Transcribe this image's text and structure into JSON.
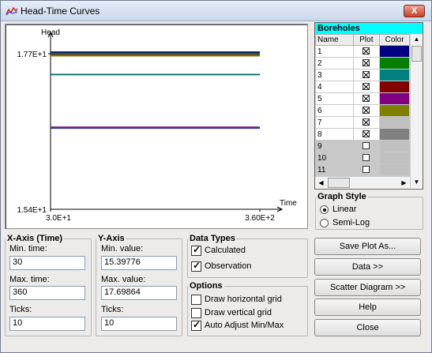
{
  "window": {
    "title": "Head-Time Curves",
    "close_label": "X"
  },
  "chart_data": {
    "type": "line",
    "ylabel": "Head",
    "xlabel": "Time",
    "yticks": [
      "1.77E+1",
      "1.54E+1"
    ],
    "xticks": [
      "3.0E+1",
      "3.60E+2"
    ],
    "ylim": [
      15.39776,
      17.69864
    ],
    "xlim": [
      30,
      360
    ],
    "series": [
      {
        "values": [
          17.72,
          17.72
        ],
        "color": "#0a0a8a"
      },
      {
        "values": [
          17.7,
          17.7
        ],
        "color": "#0a7a0a"
      },
      {
        "values": [
          17.68,
          17.68
        ],
        "color": "#7a0a0a"
      },
      {
        "values": [
          17.67,
          17.67
        ],
        "color": "#808000"
      },
      {
        "values": [
          17.39,
          17.39
        ],
        "color": "#0a7a7a"
      },
      {
        "values": [
          16.61,
          16.61
        ],
        "color": "#7a0a7a"
      },
      {
        "values": [
          16.6,
          16.6
        ],
        "color": "#3a3a8a"
      }
    ]
  },
  "boreholes": {
    "title": "Boreholes",
    "headers": [
      "Name",
      "Plot",
      "Color"
    ],
    "rows": [
      {
        "name": "1",
        "checked": true,
        "color": "#000080",
        "disabled": false
      },
      {
        "name": "2",
        "checked": true,
        "color": "#008000",
        "disabled": false
      },
      {
        "name": "3",
        "checked": true,
        "color": "#008080",
        "disabled": false
      },
      {
        "name": "4",
        "checked": true,
        "color": "#800000",
        "disabled": false
      },
      {
        "name": "5",
        "checked": true,
        "color": "#800080",
        "disabled": false
      },
      {
        "name": "6",
        "checked": true,
        "color": "#808000",
        "disabled": false
      },
      {
        "name": "7",
        "checked": true,
        "color": "#c0c0c0",
        "disabled": false
      },
      {
        "name": "8",
        "checked": true,
        "color": "#808080",
        "disabled": false
      },
      {
        "name": "9",
        "checked": false,
        "color": "#c0c0c0",
        "disabled": true
      },
      {
        "name": "10",
        "checked": false,
        "color": "#c0c0c0",
        "disabled": true
      },
      {
        "name": "11",
        "checked": false,
        "color": "#c0c0c0",
        "disabled": true
      }
    ]
  },
  "graph_style": {
    "title": "Graph Style",
    "linear": "Linear",
    "semilog": "Semi-Log",
    "selected": "linear"
  },
  "x_axis": {
    "title": "X-Axis (Time)",
    "min_label": "Min. time:",
    "min_value": "30",
    "max_label": "Max. time:",
    "max_value": "360",
    "ticks_label": "Ticks:",
    "ticks_value": "10"
  },
  "y_axis": {
    "title": "Y-Axis",
    "min_label": "Min. value:",
    "min_value": "15.39776",
    "max_label": "Max. value:",
    "max_value": "17.69864",
    "ticks_label": "Ticks:",
    "ticks_value": "10"
  },
  "data_types": {
    "title": "Data Types",
    "calculated": "Calculated",
    "observation": "Observation"
  },
  "options": {
    "title": "Options",
    "hgrid": "Draw horizontal grid",
    "vgrid": "Draw vertical grid",
    "auto": "Auto Adjust Min/Max"
  },
  "buttons": {
    "save": "Save Plot As...",
    "data": "Data >>",
    "scatter": "Scatter Diagram >>",
    "help": "Help",
    "close": "Close"
  }
}
